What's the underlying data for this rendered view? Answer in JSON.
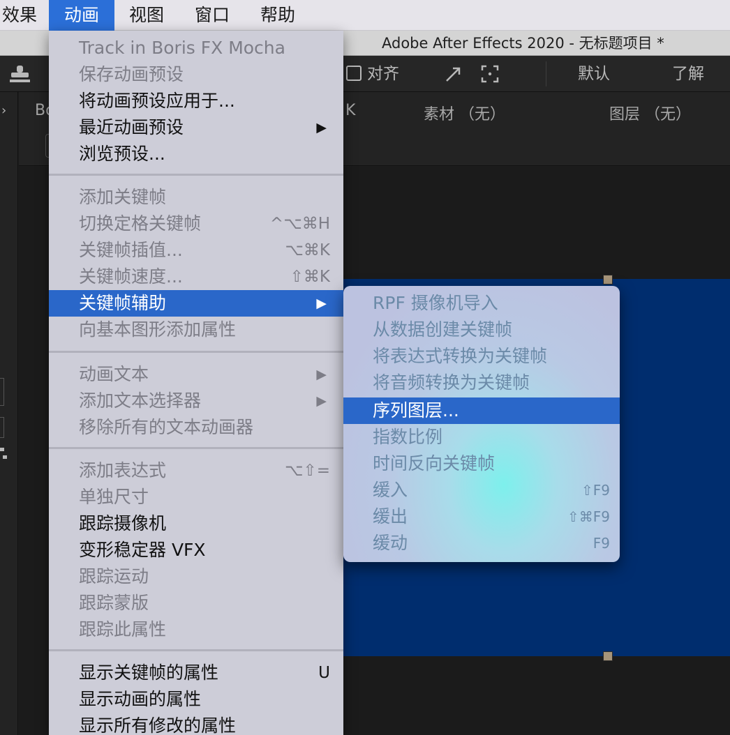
{
  "menubar": {
    "items": [
      {
        "label": "效果"
      },
      {
        "label": "动画"
      },
      {
        "label": "视图"
      },
      {
        "label": "窗口"
      },
      {
        "label": "帮助"
      }
    ]
  },
  "window": {
    "title": "Adobe After Effects 2020 - 无标题项目 *"
  },
  "toolbar": {
    "snap_label": "对齐",
    "workspace_default": "默认",
    "workspace_learn": "了解"
  },
  "panel": {
    "tab_fragment": "Bo",
    "tab_fragment_2": "K",
    "footage_label": "素材 （无）",
    "layer_label": "图层 （无）"
  },
  "menu": {
    "items": [
      {
        "label": "Track in Boris FX Mocha",
        "shortcut": "",
        "submenu": false,
        "enabled": false
      },
      {
        "label": "保存动画预设",
        "shortcut": "",
        "submenu": false,
        "enabled": false
      },
      {
        "label": "将动画预设应用于...",
        "shortcut": "",
        "submenu": false,
        "enabled": true
      },
      {
        "label": "最近动画预设",
        "shortcut": "",
        "submenu": true,
        "enabled": true
      },
      {
        "label": "浏览预设...",
        "shortcut": "",
        "submenu": false,
        "enabled": true
      },
      {
        "label": "添加关键帧",
        "shortcut": "",
        "submenu": false,
        "enabled": false
      },
      {
        "label": "切换定格关键帧",
        "shortcut": "^⌥⌘H",
        "submenu": false,
        "enabled": false
      },
      {
        "label": "关键帧插值...",
        "shortcut": "⌥⌘K",
        "submenu": false,
        "enabled": false
      },
      {
        "label": "关键帧速度...",
        "shortcut": "⇧⌘K",
        "submenu": false,
        "enabled": false
      },
      {
        "label": "关键帧辅助",
        "shortcut": "",
        "submenu": true,
        "enabled": true,
        "highlighted": true
      },
      {
        "label": "向基本图形添加属性",
        "shortcut": "",
        "submenu": false,
        "enabled": false
      },
      {
        "label": "动画文本",
        "shortcut": "",
        "submenu": true,
        "enabled": false
      },
      {
        "label": "添加文本选择器",
        "shortcut": "",
        "submenu": true,
        "enabled": false
      },
      {
        "label": "移除所有的文本动画器",
        "shortcut": "",
        "submenu": false,
        "enabled": false
      },
      {
        "label": "添加表达式",
        "shortcut": "⌥⇧=",
        "submenu": false,
        "enabled": false
      },
      {
        "label": "单独尺寸",
        "shortcut": "",
        "submenu": false,
        "enabled": false
      },
      {
        "label": "跟踪摄像机",
        "shortcut": "",
        "submenu": false,
        "enabled": true
      },
      {
        "label": "变形稳定器 VFX",
        "shortcut": "",
        "submenu": false,
        "enabled": true
      },
      {
        "label": "跟踪运动",
        "shortcut": "",
        "submenu": false,
        "enabled": false
      },
      {
        "label": "跟踪蒙版",
        "shortcut": "",
        "submenu": false,
        "enabled": false
      },
      {
        "label": "跟踪此属性",
        "shortcut": "",
        "submenu": false,
        "enabled": false
      },
      {
        "label": "显示关键帧的属性",
        "shortcut": "U",
        "submenu": false,
        "enabled": true
      },
      {
        "label": "显示动画的属性",
        "shortcut": "",
        "submenu": false,
        "enabled": true
      },
      {
        "label": "显示所有修改的属性",
        "shortcut": "",
        "submenu": false,
        "enabled": true
      }
    ],
    "submenu_arrow": "▶"
  },
  "submenu": {
    "items": [
      {
        "label": "RPF 摄像机导入",
        "shortcut": "",
        "enabled": false
      },
      {
        "label": "从数据创建关键帧",
        "shortcut": "",
        "enabled": false
      },
      {
        "label": "将表达式转换为关键帧",
        "shortcut": "",
        "enabled": false
      },
      {
        "label": "将音频转换为关键帧",
        "shortcut": "",
        "enabled": false
      },
      {
        "label": "序列图层...",
        "shortcut": "",
        "enabled": true,
        "highlighted": true
      },
      {
        "label": "指数比例",
        "shortcut": "",
        "enabled": false
      },
      {
        "label": "时间反向关键帧",
        "shortcut": "",
        "enabled": false
      },
      {
        "label": "缓入",
        "shortcut": "⇧F9",
        "enabled": false
      },
      {
        "label": "缓出",
        "shortcut": "⇧⌘F9",
        "enabled": false
      },
      {
        "label": "缓动",
        "shortcut": "F9",
        "enabled": false
      }
    ]
  },
  "colors": {
    "menu_highlight": "#2a67c9",
    "composition_bg": "#002d6e",
    "menubar_active": "#2b6fd8"
  }
}
